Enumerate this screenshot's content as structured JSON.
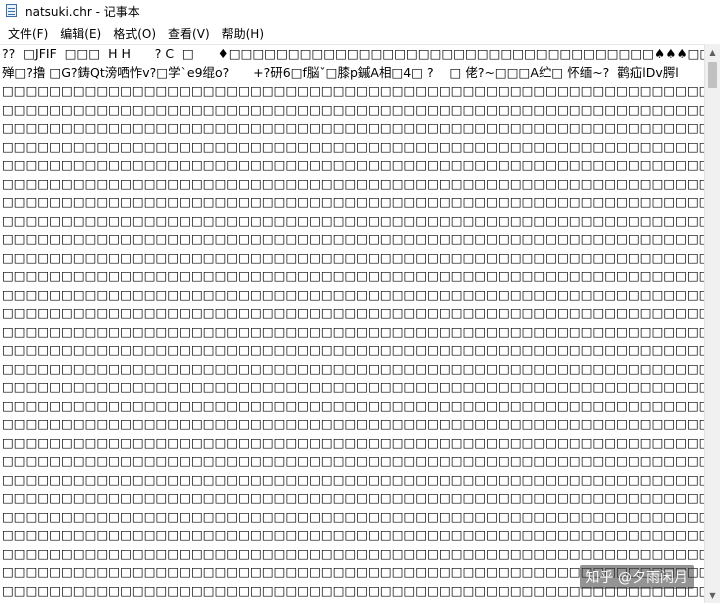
{
  "window": {
    "title": "natsuki.chr - 记事本"
  },
  "menu": [
    "文件(F)",
    "编辑(E)",
    "格式(O)",
    "查看(V)",
    "帮助(H)"
  ],
  "editor": {
    "lines": [
      "??  □JFIF  □□□  H H      ? C  □      ♦□□□□□□□□□□□□□□□□□□□□□□□□□□□□□□□□□□□□♠♠♠□□□□□□□□□□□□□□□□□□□□□□□□□",
      "殚□?撸 □G?鋳Qt滂哂怍v?□学`e9绲o?      +?研6□f脳ˇ□膝p鏚A相□4□ ?    □ 佬?~□□□A纻□ 怀缅~?  鹳疝lDv腭l",
      "□□□□□□□□□□□□□□□□□□□□□□□□□□□□□□□□□□□□□□□□□□□□□□□□□□□□□□□□□□□□□□□□□□□□□□□□□□□□□□□□□□□□□",
      "□□□□□□□□□□□□□□□□□□□□□□□□□□□□□□□□□□□□□□□□□□□□□□□□□□□□□□□□□□□□□□□□□□□□□□□□□□□□□□□□□□□□□",
      "□□□□□□□□□□□□□□□□□□□□□□□□□□□□□□□□□□□□□□□□□□□□□□□□□□□□□□□□□□□□□□□□□□□□□□□□□□□□□□□□□□□□□",
      "□□□□□□□□□□□□□□□□□□□□□□□□□□□□□□□□□□□□□□□□□□□□□□□□□□□□□□□□□□□□□□□□□□□□□□□□□□□□□□□□□□□□□",
      "□□□□□□□□□□□□□□□□□□□□□□□□□□□□□□□□□□□□□□□□□□□□□□□□□□□□□□□□□□□□□□□□□□□□□□□□□□□□□□□□□□□□□",
      "□□□□□□□□□□□□□□□□□□□□□□□□□□□□□□□□□□□□□□□□□□□□□□□□□□□□□□□□□□□□□□□□□□□□□□□□□□□□□□□□□□□□□",
      "□□□□□□□□□□□□□□□□□□□□□□□□□□□□□□□□□□□□□□□□□□□□□□□□□□□□□□□□□□□□□□□□□□□□□□□□□□□□□□□□□□□□□",
      "□□□□□□□□□□□□□□□□□□□□□□□□□□□□□□□□□□□□□□□□□□□□□□□□□□□□□□□□□□□□□□□□□□□□□□□□□□□□□□□□□□□□□",
      "□□□□□□□□□□□□□□□□□□□□□□□□□□□□□□□□□□□□□□□□□□□□□□□□□□□□□□□□□□□□□□□□□□□□□□□□□□□□□□□□□□□□□",
      "□□□□□□□□□□□□□□□□□□□□□□□□□□□□□□□□□□□□□□□□□□□□□□□□□□□□□□□□□□□□□□□□□□□□□□□□□□□□□□□□□□□□□",
      "□□□□□□□□□□□□□□□□□□□□□□□□□□□□□□□□□□□□□□□□□□□□□□□□□□□□□□□□□□□□□□□□□□□□□□□□□□□□□□□□□□□□□",
      "□□□□□□□□□□□□□□□□□□□□□□□□□□□□□□□□□□□□□□□□□□□□□□□□□□□□□□□□□□□□□□□□□□□□□□□□□□□□□□□□□□□□□",
      "□□□□□□□□□□□□□□□□□□□□□□□□□□□□□□□□□□□□□□□□□□□□□□□□□□□□□□□□□□□□□□□□□□□□□□□□□□□□□□□□□□□□□",
      "□□□□□□□□□□□□□□□□□□□□□□□□□□□□□□□□□□□□□□□□□□□□□□□□□□□□□□□□□□□□□□□□□□□□□□□□□□□□□□□□□□□□□",
      "□□□□□□□□□□□□□□□□□□□□□□□□□□□□□□□□□□□□□□□□□□□□□□□□□□□□□□□□□□□□□□□□□□□□□□□□□□□□□□□□□□□□□",
      "□□□□□□□□□□□□□□□□□□□□□□□□□□□□□□□□□□□□□□□□□□□□□□□□□□□□□□□□□□□□□□□□□□□□□□□□□□□□□□□□□□□□□",
      "□□□□□□□□□□□□□□□□□□□□□□□□□□□□□□□□□□□□□□□□□□□□□□□□□□□□□□□□□□□□□□□□□□□□□□□□□□□□□□□□□□□□□",
      "□□□□□□□□□□□□□□□□□□□□□□□□□□□□□□□□□□□□□□□□□□□□□□□□□□□□□□□□□□□□□□□□□□□□□□□□□□□□□□□□□□□□□",
      "□□□□□□□□□□□□□□□□□□□□□□□□□□□□□□□□□□□□□□□□□□□□□□□□□□□□□□□□□□□□□□□□□□□□□□□□□□□□□□□□□□□□□",
      "□□□□□□□□□□□□□□□□□□□□□□□□□□□□□□□□□□□□□□□□□□□□□□□□□□□□□□□□□□□□□□□□□□□□□□□□□□□□□□□□□□□□□",
      "□□□□□□□□□□□□□□□□□□□□□□□□□□□□□□□□□□□□□□□□□□□□□□□□□□□□□□□□□□□□□□□□□□□□□□□□□□□□□□□□□□□□□",
      "□□□□□□□□□□□□□□□□□□□□□□□□□□□□□□□□□□□□□□□□□□□□□□□□□□□□□□□□□□□□□□□□□□□□□□□□□□□□□□□□□□□□□",
      "□□□□□□□□□□□□□□□□□□□□□□□□□□□□□□□□□□□□□□□□□□□□□□□□□□□□□□□□□□□□□□□□□□□□□□□□□□□□□□□□□□□□□",
      "□□□□□□□□□□□□□□□□□□□□□□□□□□□□□□□□□□□□□□□□□□□□□□□□□□□□□□□□□□□□□□□□□□□□□□□□□□□□□□□□□□□□□",
      "□□□□□□□□□□□□□□□□□□□□□□□□□□□□□□□□□□□□□□□□□□□□□□□□□□□□□□□□□□□□□□□□□□□□□□□□□□□□□□□□□□□□□",
      "□□□□□□□□□□□□□□□□□□□□□□□□□□□□□□□□□□□□□□□□□□□□□□□□□□□□□□□□□□□□□□□□□□□□□□□□□□□□□□□□□□□□□",
      "□□□□□□□□□□□□□□□□□□□□□□□□□□□□□□□□□□□□□□□□□□□□□□□□□□□□□□□□□□□□□□□□□□□□□□□□□□□□□□□□□□□□□",
      "□□□□□□□□□□□□□□□□□□□□□□□□□□□□□□□□□□□□□□□□□□□□□□□□□□□□□□□□□□□□□□□□□□□□□□□□□□□□□□□□□□□□□"
    ]
  },
  "watermark": "知乎 @夕雨闲月"
}
